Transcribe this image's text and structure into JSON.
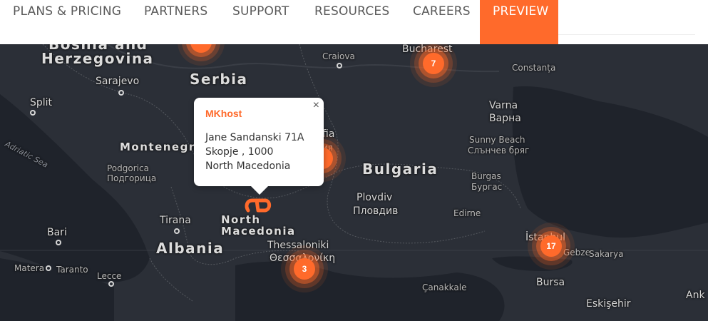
{
  "nav": {
    "items": [
      {
        "label": "PLANS & PRICING"
      },
      {
        "label": "PARTNERS"
      },
      {
        "label": "SUPPORT"
      },
      {
        "label": "RESOURCES"
      },
      {
        "label": "CAREERS"
      },
      {
        "label": "PREVIEW",
        "active": true
      }
    ],
    "accent": "#ff6a2b"
  },
  "map": {
    "countries": [
      "Serbia",
      "Montenegro",
      "Bulgaria",
      "Albania",
      "North Macedonia"
    ],
    "country_partial": [
      "Bosnia and",
      "Herzegovina"
    ],
    "cities": {
      "sarajevo": "Sarajevo",
      "split": "Split",
      "podgorica": "Podgorica",
      "podgorica_cyr": "Подгорица",
      "tirana": "Tirana",
      "bari": "Bari",
      "taranto": "Taranto",
      "matera": "Matera",
      "lecce": "Lecce",
      "craiova": "Craiova",
      "bucharest": "Bucharest",
      "constanta": "Constanța",
      "varna": "Varna",
      "varna_cyr": "Варна",
      "sunny_beach": "Sunny Beach",
      "sunny_beach_cyr": "Слънчев бряг",
      "burgas": "Burgas",
      "burgas_cyr": "Бургас",
      "plovdiv": "Plovdiv",
      "plovdiv_cyr": "Пловдив",
      "edirne": "Edirne",
      "thessaloniki": "Thessaloniki",
      "thessaloniki_cyr": "Θεσσαλονίκη",
      "istanbul": "İstanbul",
      "gebze": "Gebze",
      "sakarya": "Sakarya",
      "canakkale": "Çanakkale",
      "bursa": "Bursa",
      "eskisehir": "Eskişehir",
      "ank": "Ank",
      "sofia_partial": "fia",
      "sofia_cyr_partial": "ия"
    },
    "sea": "Adriatic Sea",
    "clusters": {
      "bucharest": "7",
      "thessaloniki": "3",
      "istanbul": "17"
    }
  },
  "popup": {
    "title": "MKhost",
    "line1": "Jane Sandanski 71A",
    "line2": "Skopje , 1000",
    "line3": "North Macedonia",
    "close": "×"
  }
}
